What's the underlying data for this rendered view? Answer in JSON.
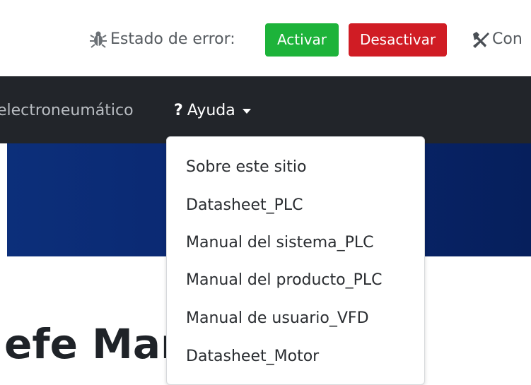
{
  "topbar": {
    "error_state_label": "Estado de error:",
    "activate_button": "Activar",
    "deactivate_button": "Desactivar",
    "config_label_partial": "Con",
    "icons": {
      "error": "bug-icon",
      "config": "tools-icon"
    }
  },
  "navbar": {
    "prev_item_partial": "electroneumático",
    "help_icon": "?",
    "help_label": "Ayuda"
  },
  "dropdown": {
    "items": [
      "Sobre este sitio",
      "Datasheet_PLC",
      "Manual del sistema_PLC",
      "Manual del producto_PLC",
      "Manual de usuario_VFD",
      "Datasheet_Motor"
    ]
  },
  "page": {
    "title_partial": "efe Man"
  },
  "colors": {
    "activate": "#1db33a",
    "deactivate": "#d01c24",
    "navbar": "#22252a",
    "hero": "#0a2770"
  }
}
